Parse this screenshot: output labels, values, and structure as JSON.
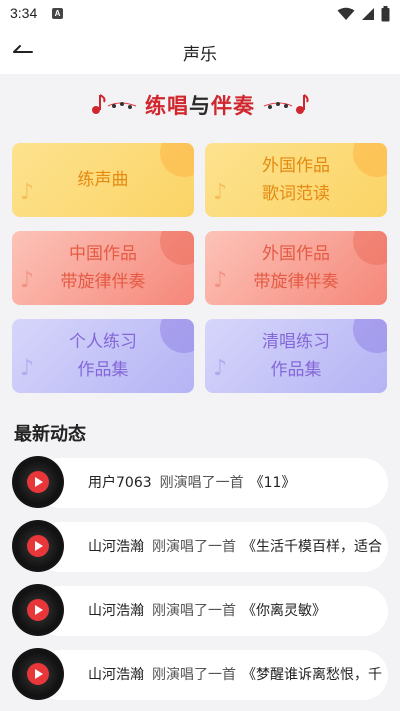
{
  "status_bar": {
    "time": "3:34",
    "notification_badge": "A"
  },
  "header": {
    "title": "声乐"
  },
  "banner": {
    "title_part1": "练唱",
    "title_part2": "与",
    "title_part3": "伴奏"
  },
  "tiles": [
    {
      "label": "练声曲",
      "theme": "yellow"
    },
    {
      "label": "外国作品\n歌词范读",
      "theme": "yellow"
    },
    {
      "label": "中国作品\n带旋律伴奏",
      "theme": "red"
    },
    {
      "label": "外国作品\n带旋律伴奏",
      "theme": "red"
    },
    {
      "label": "个人练习\n作品集",
      "theme": "purple"
    },
    {
      "label": "清唱练习\n作品集",
      "theme": "purple"
    }
  ],
  "feed": {
    "title": "最新动态",
    "items": [
      {
        "user": "用户7063",
        "action": "刚演唱了一首",
        "song": "《11》"
      },
      {
        "user": "山河浩瀚",
        "action": "刚演唱了一首",
        "song": "《生活千模百样，适合"
      },
      {
        "user": "山河浩瀚",
        "action": "刚演唱了一首",
        "song": "《你离灵敏》"
      },
      {
        "user": "山河浩瀚",
        "action": "刚演唱了一首",
        "song": "《梦醒谁诉离愁恨，千"
      }
    ]
  },
  "colors": {
    "accent_red": "#d0262d",
    "play_red": "#e8373a",
    "yellow_text": "#e48a12",
    "red_text": "#e45a44",
    "purple_text": "#8468d8"
  },
  "icons": [
    "back-arrow-icon",
    "wifi-icon",
    "signal-icon",
    "battery-icon",
    "music-note-icon",
    "play-icon",
    "vinyl-record-icon"
  ]
}
